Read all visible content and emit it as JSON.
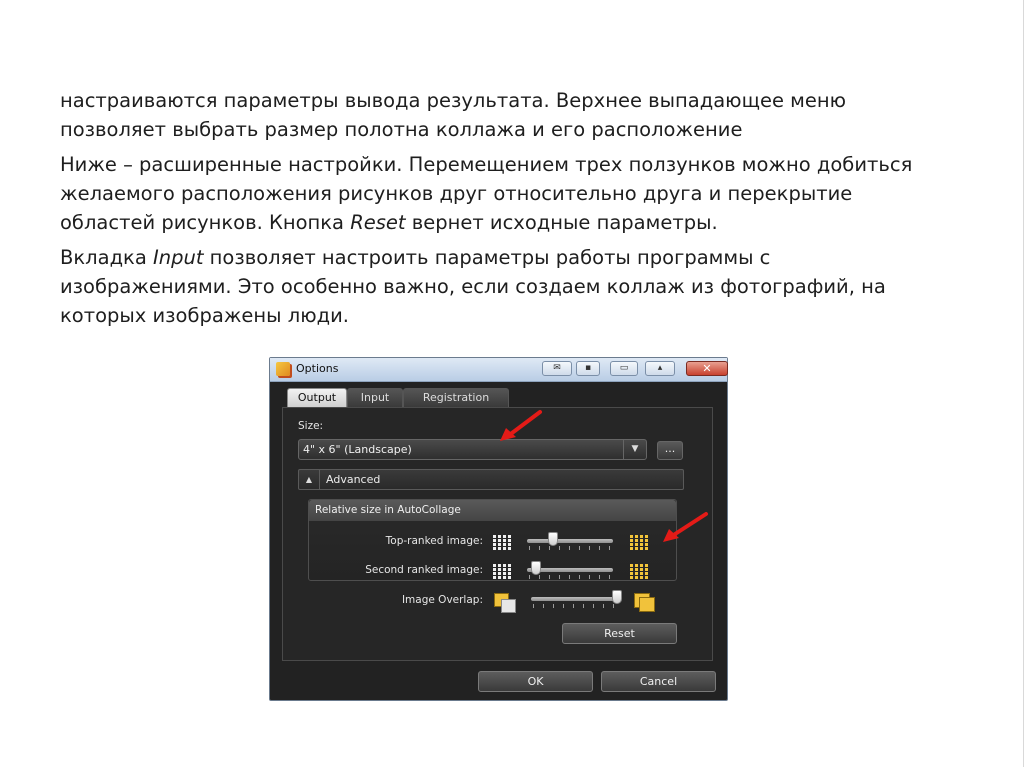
{
  "slide": {
    "paragraphs": [
      {
        "text": "настраиваются параметры вывода результата. Верхнее выпадающее меню позволяет выбрать размер полотна коллажа и его расположение"
      },
      {
        "pre": "Ниже – расширенные настройки. Перемещением трех ползунков можно добиться желаемого расположения рисунков друг относительно друга и перекрытие областей рисунков. Кнопка ",
        "em": "Reset",
        "post": " вернет исходные параметры."
      },
      {
        "pre": "Вкладка ",
        "em": "Input",
        "post": " позволяет настроить параметры работы программы с изображениями. Это особенно важно, если создаем коллаж из фотографий, на которых изображены люди."
      }
    ]
  },
  "dialog": {
    "title": "Options",
    "close_glyph": "✕",
    "tabs": [
      "Output",
      "Input",
      "Registration"
    ],
    "active_tab": "Output",
    "size_label": "Size:",
    "size_value": "4\" x 6\" (Landscape)",
    "combo_arrow_glyph": "▼",
    "browse_label": "...",
    "advanced_toggle_glyph": "▲",
    "advanced_label": "Advanced",
    "relative_title": "Relative size in AutoCollage",
    "top_ranked_label": "Top-ranked image:",
    "second_ranked_label": "Second ranked image:",
    "overlap_label": "Image Overlap:",
    "reset_label": "Reset",
    "ok_label": "OK",
    "cancel_label": "Cancel",
    "slider_values": {
      "top_ranked": 0.3,
      "second_ranked": 0.1,
      "overlap": 0.98
    },
    "arrow_color": "#e41b17"
  }
}
